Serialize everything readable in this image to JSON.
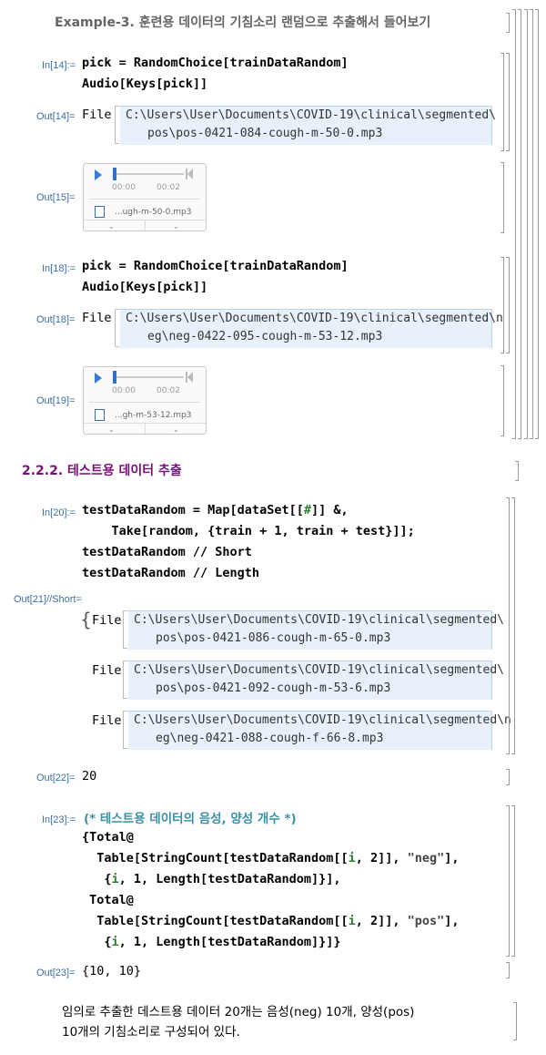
{
  "example_heading": "Example-3. 훈련용 데이터의 기침소리 랜덤으로 추출해서 들어보기",
  "cells": {
    "in14": {
      "label": "In[14]:=",
      "line1": "pick = RandomChoice[trainDataRandom]",
      "line2": "Audio[Keys[pick]]"
    },
    "out14": {
      "label": "Out[14]=",
      "file_kw": "File",
      "path1": "C:\\Users\\User\\Documents\\COVID-19\\clinical\\segmented\\",
      "path2": "pos\\pos-0421-084-cough-m-50-0.mp3"
    },
    "out15": {
      "label": "Out[15]=",
      "t0": "00:00",
      "t1": "00:02",
      "filename": "...ugh-m-50-0.mp3"
    },
    "in18": {
      "label": "In[18]:=",
      "line1": "pick = RandomChoice[trainDataRandom]",
      "line2": "Audio[Keys[pick]]"
    },
    "out18": {
      "label": "Out[18]=",
      "file_kw": "File",
      "path1": "C:\\Users\\User\\Documents\\COVID-19\\clinical\\segmented\\n",
      "path2": "eg\\neg-0422-095-cough-m-53-12.mp3"
    },
    "out19": {
      "label": "Out[19]=",
      "t0": "00:00",
      "t1": "00:02",
      "filename": "...gh-m-53-12.mp3"
    },
    "section_title": "2.2.2. 테스트용 데이터 추출",
    "in20": {
      "label": "In[20]:=",
      "line1a": "testDataRandom = Map[dataSet[[",
      "line1var": "#",
      "line1b": "]] &,",
      "line2": "    Take[random, {train + 1, train + test}]];",
      "line3": "testDataRandom // Short",
      "line4": "testDataRandom // Length"
    },
    "out21": {
      "label": "Out[21]//Short=",
      "file_kw": "File",
      "files": [
        {
          "path1": "C:\\Users\\User\\Documents\\COVID-19\\clinical\\segmented\\",
          "path2": "pos\\pos-0421-086-cough-m-65-0.mp3"
        },
        {
          "path1": "C:\\Users\\User\\Documents\\COVID-19\\clinical\\segmented\\",
          "path2": "pos\\pos-0421-092-cough-m-53-6.mp3"
        },
        {
          "path1": "C:\\Users\\User\\Documents\\COVID-19\\clinical\\segmented\\n",
          "path2": "eg\\neg-0421-088-cough-f-66-8.mp3"
        }
      ]
    },
    "out22": {
      "label": "Out[22]=",
      "value": "20"
    },
    "in23": {
      "label": "In[23]:=",
      "comment": "(* 테스트용 데이터의 음성, 양성 개수 *)",
      "l1": "{Total@",
      "l2a": "  Table[StringCount[testDataRandom[[",
      "l2i": "i",
      "l2b": ", 2]], ",
      "l2s": "\"neg\"",
      "l2c": "],",
      "l3a": "   {",
      "l3i": "i",
      "l3b": ", 1, Length[testDataRandom]}],",
      "l4": " Total@",
      "l5a": "  Table[StringCount[testDataRandom[[",
      "l5i": "i",
      "l5b": ", 2]], ",
      "l5s": "\"pos\"",
      "l5c": "],",
      "l6a": "   {",
      "l6i": "i",
      "l6b": ", 1, Length[testDataRandom]}]}"
    },
    "out23": {
      "label": "Out[23]=",
      "value": "{10, 10}"
    }
  },
  "conclusion_line1": "임의로 추출한 데스트용 데이터 20개는 음성(neg) 10개, 양성(pos)",
  "conclusion_line2": "10개의 기침소리로 구성되어 있다."
}
